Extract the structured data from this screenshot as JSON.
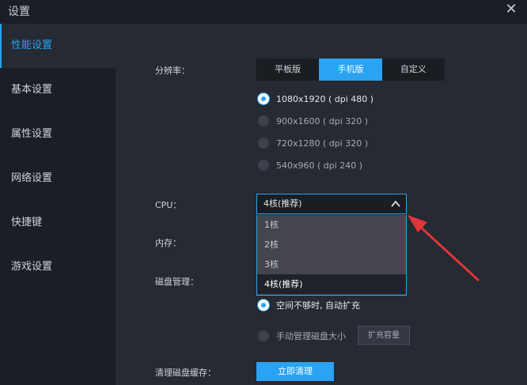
{
  "window": {
    "title": "设置",
    "close_icon": "✕"
  },
  "sidebar": {
    "items": [
      {
        "label": "性能设置",
        "active": true
      },
      {
        "label": "基本设置"
      },
      {
        "label": "属性设置"
      },
      {
        "label": "网络设置"
      },
      {
        "label": "快捷键"
      },
      {
        "label": "游戏设置"
      }
    ]
  },
  "resolution": {
    "label": "分辨率：",
    "modes": [
      "平板版",
      "手机版",
      "自定义"
    ],
    "selected_mode": "手机版",
    "options": [
      "1080x1920 ( dpi 480 )",
      "900x1600 ( dpi 320 )",
      "720x1280 ( dpi 320 )",
      "540x960 ( dpi 240 )"
    ],
    "selected_option": "1080x1920 ( dpi 480 )"
  },
  "cpu": {
    "label": "CPU：",
    "value": "4核(推荐)",
    "chevron_icon": "chevron-up-icon",
    "options": [
      "1核",
      "2核",
      "3核",
      "4核(推荐)"
    ]
  },
  "memory": {
    "label": "内存："
  },
  "disk": {
    "label": "磁盘管理：",
    "options": [
      "空间不够时, 自动扩充",
      "手动管理磁盘大小"
    ],
    "selected_option": "空间不够时, 自动扩充",
    "expand_button": "扩充容量"
  },
  "cache": {
    "label": "清理磁盘缓存：",
    "button": "立即清理"
  },
  "colors": {
    "accent": "#2aa3f2",
    "annotation_arrow": "#e0353a"
  }
}
